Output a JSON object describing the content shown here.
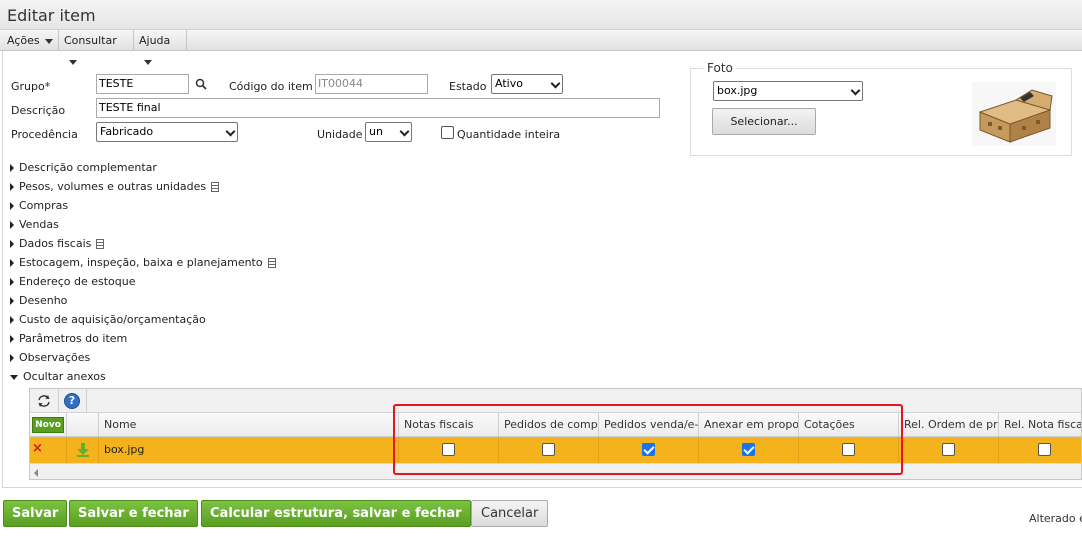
{
  "window": {
    "title": "Editar item"
  },
  "menu": [
    {
      "label": "Ações"
    },
    {
      "label": "Consultar"
    },
    {
      "label": "Ajuda"
    }
  ],
  "form": {
    "grupo_label": "Grupo*",
    "grupo_value": "TESTE",
    "codigo_label": "Código do item",
    "codigo_value": "IT00044",
    "estado_label": "Estado",
    "estado_value": "Ativo",
    "descricao_label": "Descrição",
    "descricao_value": "TESTE final",
    "procedencia_label": "Procedência",
    "procedencia_value": "Fabricado",
    "unidade_label": "Unidade",
    "unidade_value": "un",
    "quantidade_inteira_label": "Quantidade inteira",
    "quantidade_inteira_checked": false
  },
  "foto": {
    "legend": "Foto",
    "file_value": "box.jpg",
    "select_button": "Selecionar..."
  },
  "sections": [
    {
      "label": "Descrição complementar",
      "has_doc": false
    },
    {
      "label": "Pesos, volumes e outras unidades",
      "has_doc": true
    },
    {
      "label": "Compras",
      "has_doc": false
    },
    {
      "label": "Vendas",
      "has_doc": false
    },
    {
      "label": "Dados fiscais",
      "has_doc": true
    },
    {
      "label": "Estocagem, inspeção, baixa e planejamento",
      "has_doc": true
    },
    {
      "label": "Endereço de estoque",
      "has_doc": false
    },
    {
      "label": "Desenho",
      "has_doc": false
    },
    {
      "label": "Custo de aquisição/orçamentação",
      "has_doc": false
    },
    {
      "label": "Parâmetros do item",
      "has_doc": false
    },
    {
      "label": "Observações",
      "has_doc": false
    },
    {
      "label": "Ocultar anexos",
      "has_doc": false,
      "expanded": true
    }
  ],
  "attachments": {
    "novo_label": "Novo",
    "help_glyph": "?",
    "delete_glyph": "×",
    "columns": [
      "Nome",
      "Notas fiscais",
      "Pedidos de compra",
      "Pedidos venda/e-mail",
      "Anexar em proposta",
      "Cotações",
      "Rel. Ordem de produção",
      "Rel. Nota fiscal"
    ],
    "row": {
      "nome": "box.jpg",
      "checks": [
        false,
        false,
        true,
        true,
        false,
        false,
        false
      ]
    },
    "highlight_color": "#e8141c",
    "row_color": "#f4b21c"
  },
  "buttons": {
    "salvar": "Salvar",
    "salvar_fechar": "Salvar e fechar",
    "calcular": "Calcular estrutura, salvar e fechar",
    "cancelar": "Cancelar"
  },
  "footer": {
    "status": "Alterado e"
  },
  "colors": {
    "green": "#6ab32e",
    "accent_blue": "#1a73e8"
  }
}
